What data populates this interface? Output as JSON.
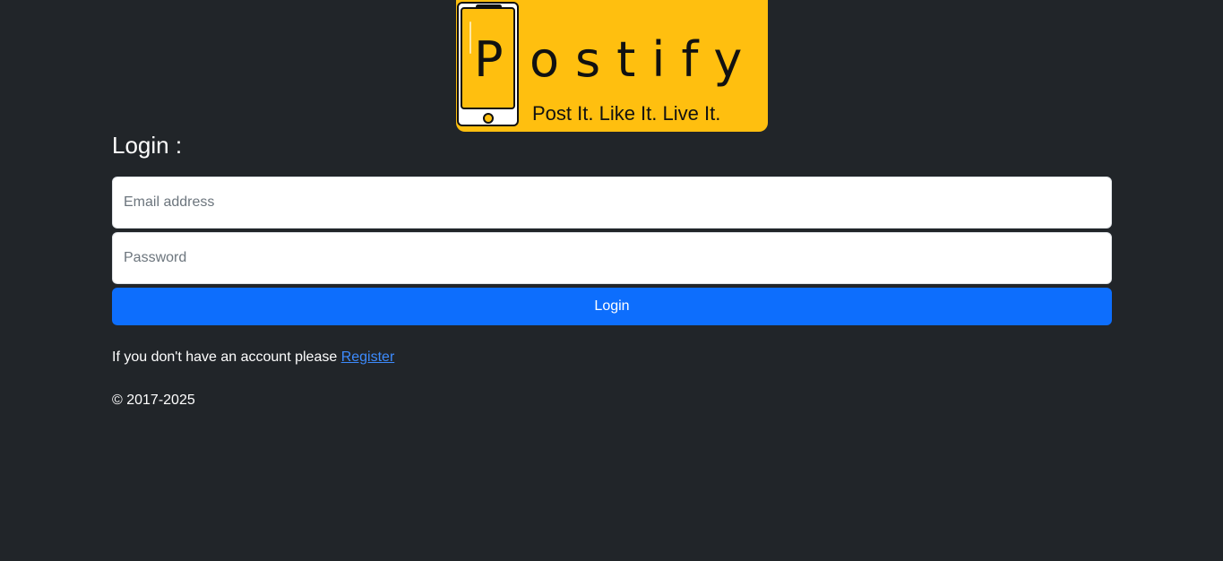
{
  "logo": {
    "wordmark_first": "P",
    "wordmark_rest": "ostify",
    "tagline": "Post It. Like It. Live It.",
    "accent_color": "#ffbf0f",
    "icon": "smartphone-icon"
  },
  "login": {
    "heading": "Login :",
    "email_placeholder": "Email address",
    "password_placeholder": "Password",
    "submit_label": "Login",
    "primary_color": "#0d6efd"
  },
  "register": {
    "prompt": "If you don't have an account please ",
    "link_label": "Register"
  },
  "footer": {
    "copyright": "© 2017-2025"
  },
  "theme": {
    "background": "#212529"
  }
}
